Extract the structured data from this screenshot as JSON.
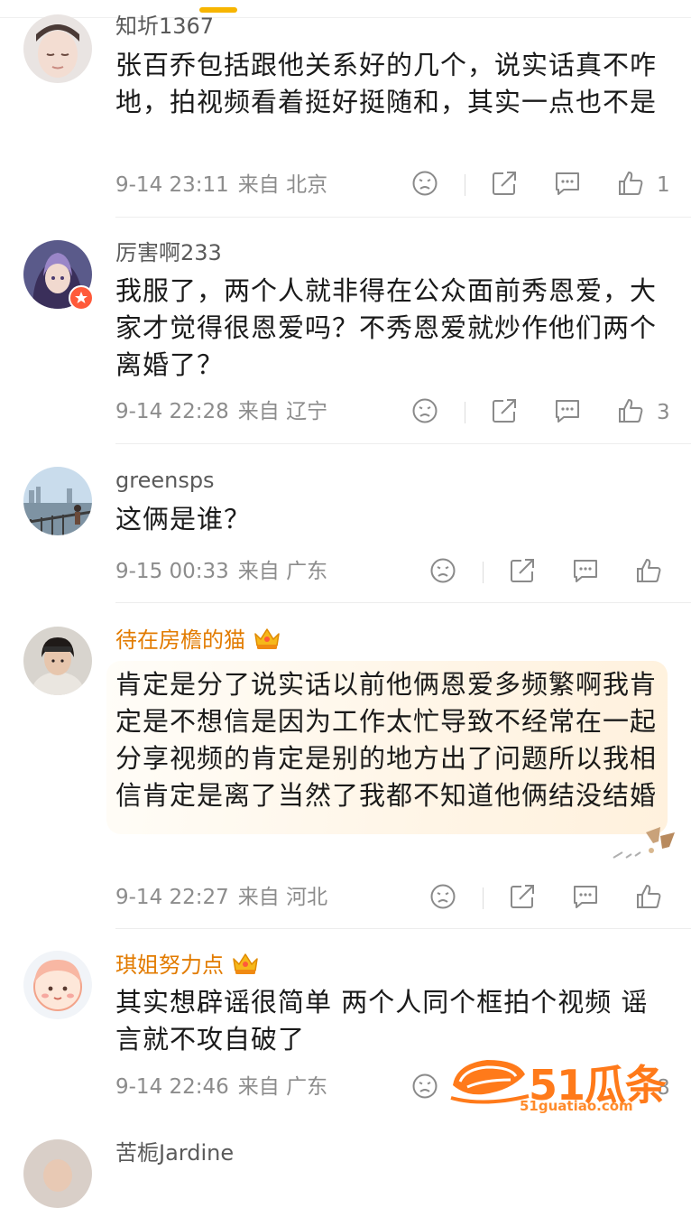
{
  "comments": [
    {
      "username": "知圻1367",
      "content": "张百乔包括跟他关系好的几个，说实话真不咋地，拍视频看着挺好挺随和，其实一点也不是",
      "time": "9-14 23:11",
      "from": "来自 北京",
      "likes": "1"
    },
    {
      "username": "厉害啊233",
      "content": "我服了，两个人就非得在公众面前秀恩爱，大家才觉得很恩爱吗？不秀恩爱就炒作他们两个离婚了？",
      "time": "9-14 22:28",
      "from": "来自 辽宁",
      "likes": "3"
    },
    {
      "username": "greensps",
      "content": "这俩是谁？",
      "time": "9-15 00:33",
      "from": "来自 广东",
      "likes": ""
    },
    {
      "username": "待在房檐的猫",
      "content": "肯定是分了说实话以前他俩恩爱多频繁啊我肯定是不想信是因为工作太忙导致不经常在一起分享视频的肯定是别的地方出了问题所以我相信肯定是离了当然了我都不知道他俩结没结婚",
      "time": "9-14 22:27",
      "from": "来自 河北",
      "likes": ""
    },
    {
      "username": "琪姐努力点",
      "content": "其实想辟谣很简单 两个人同个框拍个视频 谣言就不攻自破了",
      "time": "9-14 22:46",
      "from": "来自 广东",
      "likes": "8"
    },
    {
      "username": "苦栀Jardine"
    }
  ],
  "watermark": {
    "text": "51瓜条",
    "url": "51guatiao.com"
  },
  "colors": {
    "accent": "#f7b500",
    "vip_name": "#e27b00",
    "meta": "#8c8c8c",
    "icon": "#8a8a8a"
  }
}
